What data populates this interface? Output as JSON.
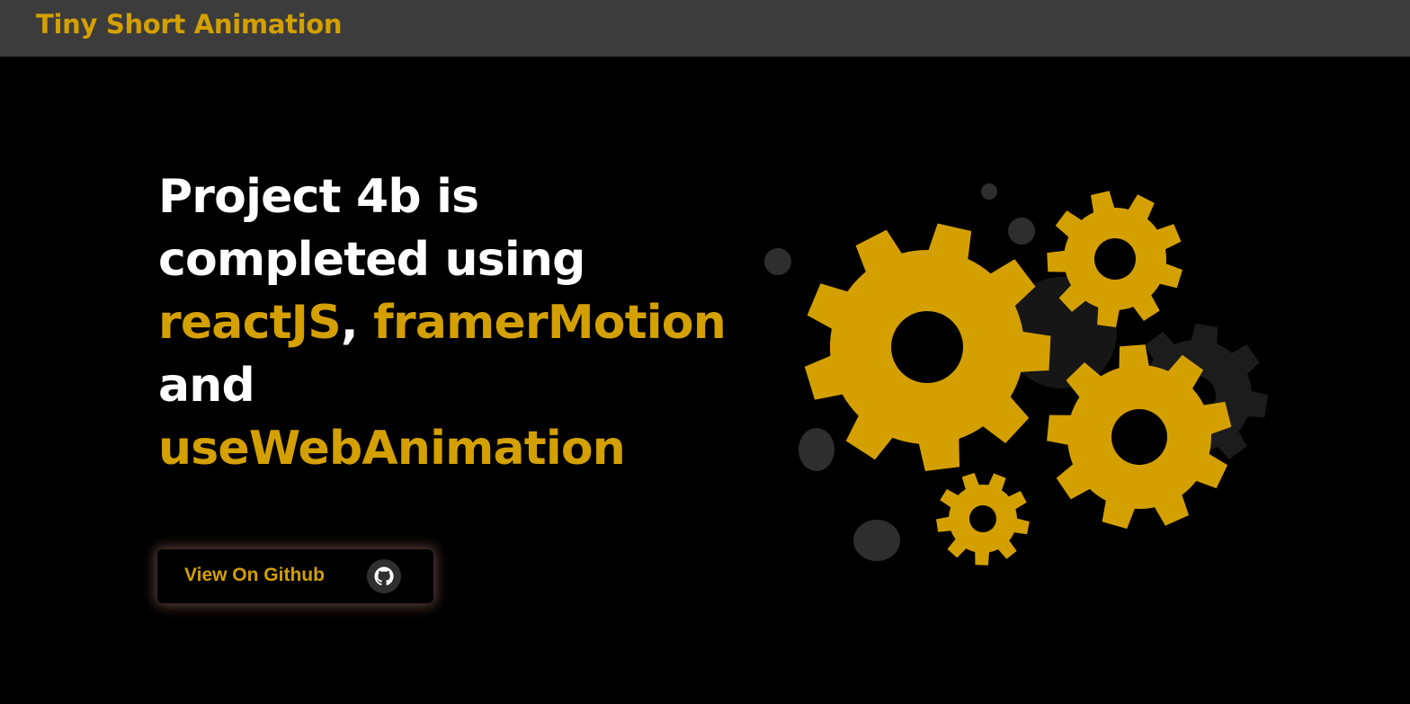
{
  "navbar": {
    "brand": "Tiny Short Animation"
  },
  "hero": {
    "line1": "Project 4b is",
    "line2": "completed using",
    "tech1": "reactJS",
    "separator": ",",
    "tech2": "framerMotion",
    "conjunction": "and",
    "tech3": "useWebAnimation"
  },
  "cta": {
    "label": "View On Github",
    "icon": "github-icon"
  },
  "illustration": {
    "icon": "gears-icon"
  },
  "colors": {
    "accent": "#d4a000",
    "navbar": "#3c3c3c",
    "background": "#000000",
    "text": "#ffffff"
  }
}
